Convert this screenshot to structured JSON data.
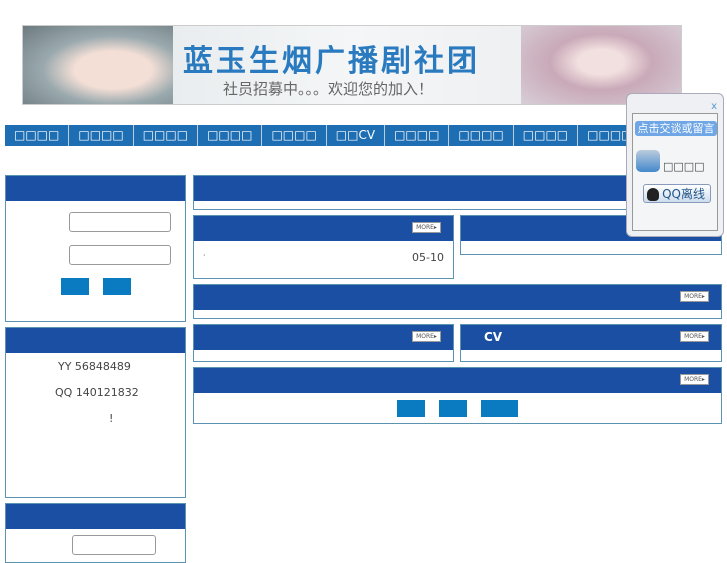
{
  "banner": {
    "title": "蓝玉生烟广播剧社团",
    "subtitle": "社员招募中。。。欢迎您的加入！"
  },
  "nav": [
    "□□□□",
    "□□□□",
    "□□□□",
    "□□□□",
    "□□□□",
    "□□CV",
    "□□□□",
    "□□□□",
    "□□□□",
    "□□□□"
  ],
  "contact": {
    "yy": "YY  56848489",
    "qq": "QQ 140121832",
    "note": "!"
  },
  "news": {
    "bullet": "·",
    "date": "05-10"
  },
  "cv_label": "CV",
  "more": "MORE▸",
  "qq_panel": {
    "close": "x",
    "talk": "点击交谈或留言",
    "name": "□□□□",
    "status": "QQ离线"
  }
}
